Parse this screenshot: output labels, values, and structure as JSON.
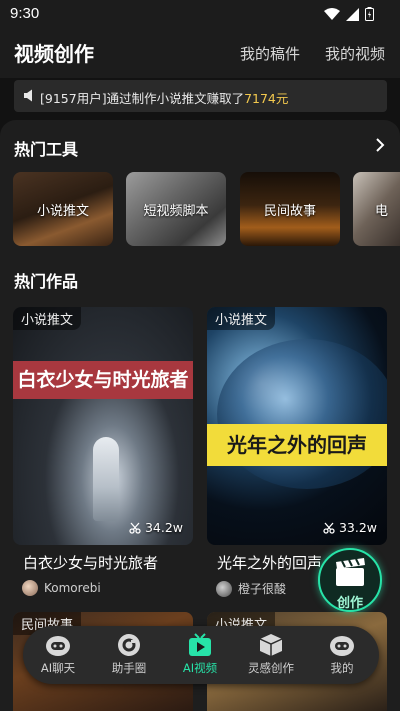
{
  "status": {
    "time": "9:30"
  },
  "header": {
    "title": "视频创作",
    "links": [
      "我的稿件",
      "我的视频"
    ]
  },
  "notice": {
    "text": "[9157用户]通过制作小说推文赚取了",
    "amount": "7174元"
  },
  "tools": {
    "title": "热门工具",
    "items": [
      {
        "label": "小说推文"
      },
      {
        "label": "短视频脚本"
      },
      {
        "label": "民间故事"
      },
      {
        "label": "电"
      }
    ]
  },
  "works": {
    "title": "热门作品",
    "items": [
      {
        "tag": "小说推文",
        "cover_title": "白衣少女与时光旅者",
        "views": "34.2w",
        "title": "白衣少女与时光旅者",
        "author": "Komorebi"
      },
      {
        "tag": "小说推文",
        "cover_title": "光年之外的回声",
        "views": "33.2w",
        "title": "光年之外的回声",
        "author": "橙子很酸"
      }
    ],
    "next_tags": [
      "民间故事",
      "小说推文"
    ]
  },
  "create_button": {
    "label": "创作"
  },
  "bottom_nav": {
    "items": [
      {
        "label": "AI聊天",
        "icon": "robot-icon",
        "active": false
      },
      {
        "label": "助手圈",
        "icon": "circle-icon",
        "active": false
      },
      {
        "label": "AI视频",
        "icon": "tv-play-icon",
        "active": true
      },
      {
        "label": "灵感创作",
        "icon": "cube-icon",
        "active": false
      },
      {
        "label": "我的",
        "icon": "profile-robot-icon",
        "active": false
      }
    ]
  },
  "colors": {
    "accent": "#27e3a8",
    "amount": "#f3c94e",
    "background": "#121212"
  }
}
